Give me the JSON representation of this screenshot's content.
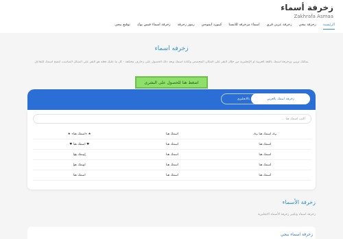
{
  "header": {
    "title": "زخرفة أسماء",
    "subtitle": "Zakhrafa Asmaa"
  },
  "nav": {
    "items": [
      {
        "label": "الرئيسية"
      },
      {
        "label": "زخرفة ببجي"
      },
      {
        "label": "زخرفة عربي فري"
      },
      {
        "label": "اسماء مزخرفه للانستا"
      },
      {
        "label": "كيبورد ايموجي"
      },
      {
        "label": "رموز زخرفة"
      },
      {
        "label": "زخرفة اسماء فيس بوك"
      },
      {
        "label": "توقيع ببجي"
      }
    ]
  },
  "hero": {
    "title": "زخرفه اسماء",
    "description": "يمكنك تزيين وزخرفة اسمك باللغة العربية أو الإنجليزية من خلال النقر على المكان المخصص وكتابة اسمك وبعد ذلك الحصول على زخارف مختلفة - كل ما عليك فعله هو النقر على الشكل المناسب لنسخ اسمك للتفاعل",
    "share_button": "اضغط هنا للحصول على البشرى"
  },
  "tool": {
    "tab_arabic": "زخرفة اسمك بالعربي",
    "tab_english": "زخرفة اسمك بالانجليزي",
    "input_placeholder": "اكتب اسمك هنا ..."
  },
  "results": [
    [
      "★ ٭اسمك هنا٭ ★",
      "اسمك هنا",
      "ـﮩ٨ـ اسمك هنا ـﮩ٨ـ"
    ],
    [
      "♥ اسمك هنا ♥",
      "اسمك هنا",
      "اسمك هنا"
    ],
    [
      "ا͢سمك ه͢نا",
      "اسمك هنا",
      "اسمك هنا"
    ],
    [
      "ا̲سمك ه̲نا",
      "اسمك هنا",
      "اسمك هنا"
    ],
    [
      "اسمك هنا",
      "اسمك هنا",
      "اسمك هنا"
    ]
  ],
  "section": {
    "title": "زخرفة الأسماء",
    "description": "زخرفة اسماء وتكبير زخرفة الأسماء الانجليزية"
  },
  "bottom": {
    "title": "زخرفة اسماء ببجي"
  }
}
